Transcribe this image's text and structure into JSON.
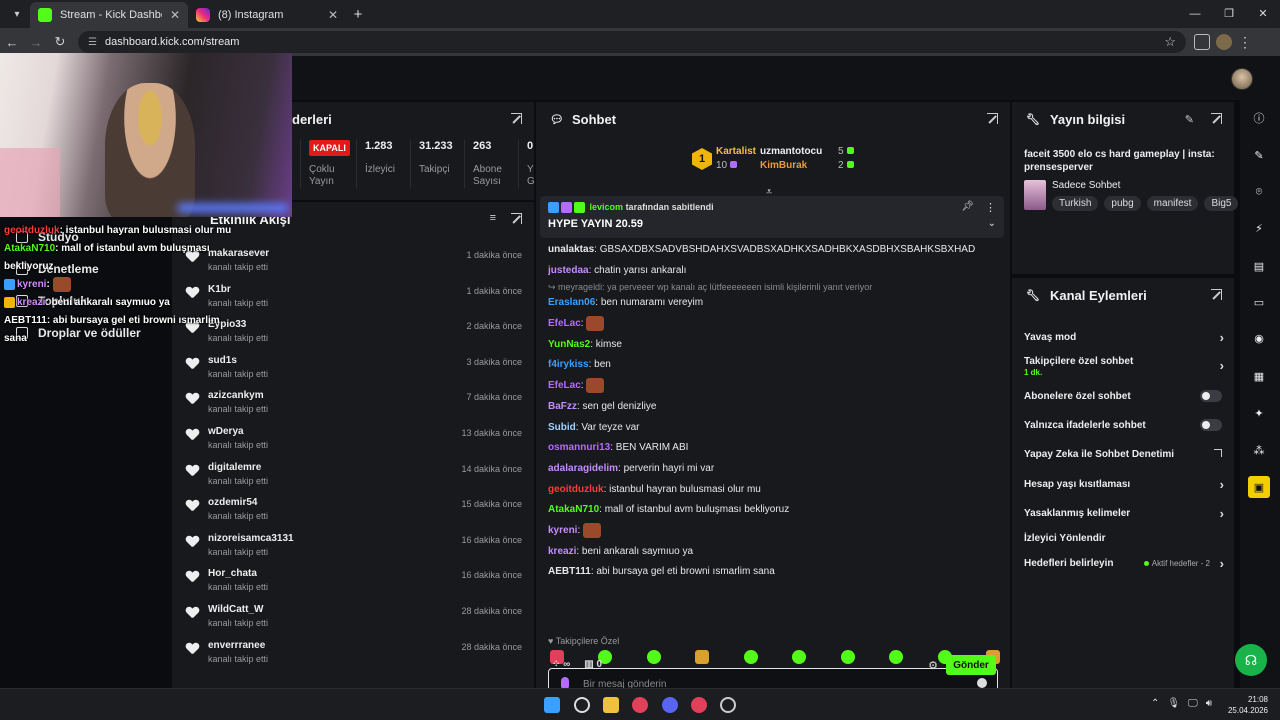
{
  "browser": {
    "tabs": [
      {
        "title": "Stream - Kick Dashboard",
        "active": true
      },
      {
        "title": "(8) Instagram",
        "active": false
      }
    ],
    "url": "dashboard.kick.com/stream"
  },
  "sidebar": {
    "items": [
      {
        "label": "Stüdyo"
      },
      {
        "label": "Denetleme"
      },
      {
        "label": "Topluluk"
      },
      {
        "label": "Droplar ve ödüller"
      }
    ]
  },
  "stream_overlay_chat": [
    {
      "user": "geoitduzluk",
      "text": ": istanbul hayran bulusmasi olur mu"
    },
    {
      "user": "AtakaN710",
      "text": ": mall of istanbul avm buluşması bekliyoruz"
    },
    {
      "user": "kyreni",
      "text": ":"
    },
    {
      "user": "kreazi",
      "text": ": beni ankaralı saymıuo ya"
    },
    {
      "user": "AEBT111",
      "text": ": abi bursaya gel eti browni ısmarlim sana"
    }
  ],
  "stats": {
    "title": "derleri",
    "status": "KAPALI",
    "status_label": "Çoklu Yayın",
    "items": [
      {
        "value": "1.283",
        "label": "İzleyici"
      },
      {
        "value": "31.233",
        "label": "Takipçi"
      },
      {
        "value": "263",
        "label": "Abone Sayısı"
      },
      {
        "value": "0",
        "label": "Y G"
      }
    ]
  },
  "activity": {
    "title": "Etkinlik Akışı",
    "rows": [
      {
        "name": "makarasever",
        "desc": "kanalı takip etti",
        "time": "1 dakika önce"
      },
      {
        "name": "K1br",
        "desc": "kanalı takip etti",
        "time": "1 dakika önce"
      },
      {
        "name": "Eypio33",
        "desc": "kanalı takip etti",
        "time": "2 dakika önce"
      },
      {
        "name": "sud1s",
        "desc": "kanalı takip etti",
        "time": "3 dakika önce"
      },
      {
        "name": "azizcankym",
        "desc": "kanalı takip etti",
        "time": "7 dakika önce"
      },
      {
        "name": "wDerya",
        "desc": "kanalı takip etti",
        "time": "13 dakika önce"
      },
      {
        "name": "digitalemre",
        "desc": "kanalı takip etti",
        "time": "14 dakika önce"
      },
      {
        "name": "ozdemir54",
        "desc": "kanalı takip etti",
        "time": "15 dakika önce"
      },
      {
        "name": "nizoreisamca3131",
        "desc": "kanalı takip etti",
        "time": "16 dakika önce"
      },
      {
        "name": "Hor_chata",
        "desc": "kanalı takip etti",
        "time": "16 dakika önce"
      },
      {
        "name": "WildCatt_W",
        "desc": "kanalı takip etti",
        "time": "28 dakika önce"
      },
      {
        "name": "enverrranee",
        "desc": "kanalı takip etti",
        "time": "28 dakika önce"
      }
    ]
  },
  "chat": {
    "title": "Sohbet",
    "leaderboard": {
      "first": {
        "rank": "1",
        "name": "Kartalist",
        "count": "10"
      },
      "second": {
        "name": "uzmantotocu",
        "count": "5"
      },
      "third": {
        "name": "KimBurak",
        "count": "2"
      }
    },
    "pinned": {
      "by_user": "levicom",
      "by_text": "tarafından sabitlendi",
      "message": "HYPE YAYIN 20.59"
    },
    "messages": [
      {
        "user": "unalaktas",
        "text": ": GBSAXDBXSADVBSHDAHXSVADBSXADHKXSADHBKXASDBHXSBAHKSBXHAD",
        "color": "#e8e8e8"
      },
      {
        "user": "justedaa",
        "text": ": chatin yarısı ankaralı",
        "color": "#c58cff"
      },
      {
        "reply": "meyrageldi: ya perveeer wp kanalı aç lütfeeeeeeen isimli kişilerinli yanıt veriyor"
      },
      {
        "user": "Eraslan06",
        "text": ": ben numaramı vereyim",
        "color": "#3aa0ff"
      },
      {
        "user": "EfeLac",
        "text": ":",
        "color": "#b46cff",
        "emote": true
      },
      {
        "user": "YunNas2",
        "text": ": kimse",
        "color": "#53fc18"
      },
      {
        "user": "f4irykiss",
        "text": ": ben",
        "color": "#3aa0ff"
      },
      {
        "user": "EfeLac",
        "text": ":",
        "color": "#b46cff",
        "emote": true
      },
      {
        "user": "BaFzz",
        "text": ": sen gel denizliye",
        "color": "#c58cff"
      },
      {
        "user": "Subid",
        "text": ": Var teyze var",
        "color": "#9fd3ff"
      },
      {
        "user": "osmannuri13",
        "text": ": BEN VARIM ABI",
        "color": "#b46cff"
      },
      {
        "user": "adalaragidelim",
        "text": ": perverin hayri mi var",
        "color": "#c58cff"
      },
      {
        "user": "geoitduzluk",
        "text": ": istanbul hayran bulusmasi olur mu",
        "color": "#ff3b3b"
      },
      {
        "user": "AtakaN710",
        "text": ": mall of istanbul avm buluşması bekliyoruz",
        "color": "#53fc18"
      },
      {
        "user": "kyreni",
        "text": ":",
        "color": "#c58cff",
        "emote": true
      },
      {
        "user": "kreazi",
        "text": ": beni ankaralı saymıuo ya",
        "color": "#c58cff"
      },
      {
        "user": "AEBT111",
        "text": ": abi bursaya gel eti browni ısmarlim sana",
        "color": "#e8e8e8"
      }
    ],
    "followers_only": "Takipçilere Özel",
    "input_placeholder": "Bir mesaj gönderin",
    "footer_count_left": "∞",
    "footer_count_right": "0",
    "send_label": "Gönder"
  },
  "stream_info": {
    "title": "Yayın bilgisi",
    "stream_title": "faceit 3500 elo cs hard gameplay | insta: prensesperver",
    "category": "Sadece Sohbet",
    "tags": [
      "Turkish",
      "pubg",
      "manifest",
      "Big5"
    ]
  },
  "channel_actions": {
    "title": "Kanal Eylemleri",
    "items": [
      {
        "label": "Yavaş mod"
      },
      {
        "label": "Takipçilere özel sohbet",
        "sub": "1 dk."
      },
      {
        "label": "Abonelere özel sohbet"
      },
      {
        "label": "Yalnızca ifadelerle sohbet"
      },
      {
        "label": "Yapay Zeka ile Sohbet Denetimi"
      },
      {
        "label": "Hesap yaşı kısıtlaması"
      },
      {
        "label": "Yasaklanmış kelimeler"
      },
      {
        "label": "İzleyici Yönlendir"
      },
      {
        "label": "Hedefleri belirleyin",
        "aside": "Aktif hedefler - 2"
      }
    ]
  },
  "taskbar": {
    "time": "21:08",
    "date": "25.04.2026"
  },
  "colors": {
    "kick_green": "#53fc18",
    "panel_bg": "#18191d",
    "live_off_red": "#e01919"
  }
}
